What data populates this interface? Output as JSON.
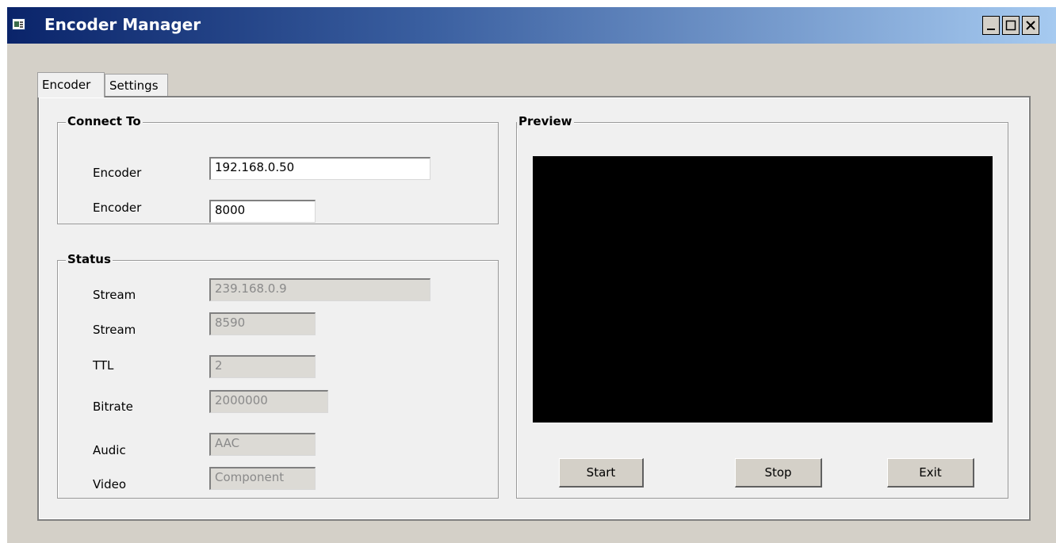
{
  "window": {
    "title": "Encoder Manager",
    "controls": {
      "minimize": "_",
      "maximize": "□",
      "close": "×"
    }
  },
  "tabs": [
    {
      "label": "Encoder",
      "active": true
    },
    {
      "label": "Settings",
      "active": false
    }
  ],
  "connect_to": {
    "title": "Connect To",
    "rows": [
      {
        "label": "Encoder",
        "value": "192.168.0.50"
      },
      {
        "label": "Encoder",
        "value": "8000"
      }
    ]
  },
  "status": {
    "title": "Status",
    "rows": [
      {
        "label": "Stream",
        "value": "239.168.0.9"
      },
      {
        "label": "Stream",
        "value": "8590"
      },
      {
        "label": "TTL",
        "value": "2"
      },
      {
        "label": "Bitrate",
        "value": "2000000"
      },
      {
        "label": "Audic",
        "value": "AAC"
      },
      {
        "label": "Video",
        "value": "Component"
      }
    ]
  },
  "preview": {
    "title": "Preview",
    "buttons": {
      "start": "Start",
      "stop": "Stop",
      "exit": "Exit"
    }
  },
  "colors": {
    "titlebar_start": "#0a246a",
    "titlebar_end": "#a6caf0",
    "preview_background": "#000000"
  }
}
